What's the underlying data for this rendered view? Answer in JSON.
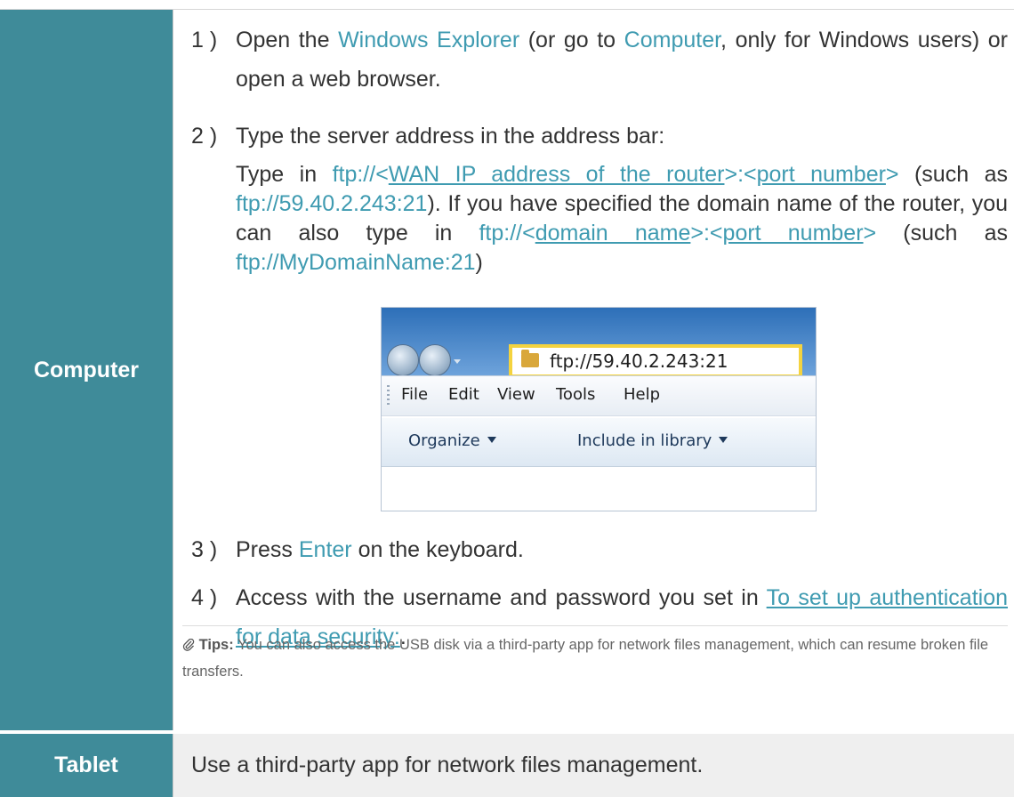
{
  "rows": {
    "computer": {
      "label": "Computer",
      "steps": [
        {
          "num": "1 )",
          "p1": "Open the ",
          "link1": "Windows Explorer",
          "p2": " (or go to ",
          "link2": "Computer",
          "p3": ", only for Windows users) or open a web browser."
        },
        {
          "num": "2 )",
          "text": "Type the server address in the address bar:",
          "detail": {
            "p1": "Type in ",
            "ftp1": "ftp://<",
            "ftp1_u": "WAN IP address of the router",
            "ftp1_mid": ">:<",
            "ftp1_u2": "port number",
            "ftp1_end": ">",
            "p2": " (such as ",
            "ex1": "ftp://59.40.2.243:21",
            "p3": "). If you have specified the domain name of the router, you can also type in ",
            "ftp2": "ftp://<",
            "ftp2_u": "domain name",
            "ftp2_mid": ">:<",
            "ftp2_u2": "port number",
            "ftp2_end": ">",
            "p4": " (such as ",
            "ex2": "ftp://MyDomainName:21",
            "p5": ")"
          }
        },
        {
          "num": "3 )",
          "p1": "Press ",
          "link1": "Enter",
          "p2": " on the keyboard."
        },
        {
          "num": "4 )",
          "p1": "Access with the username and password you set in ",
          "link1": "To set up authentication for data security:",
          "p2": "."
        }
      ],
      "explorer": {
        "address": "ftp://59.40.2.243:21",
        "menu": [
          "File",
          "Edit",
          "View",
          "Tools",
          "Help"
        ],
        "commands": [
          "Organize",
          "Include in library"
        ]
      },
      "tips": {
        "label": "Tips:",
        "text": " You can also access the USB disk via a third-party app for network files management, which can resume broken file transfers."
      }
    },
    "tablet": {
      "label": "Tablet",
      "text": "Use a third-party app for network files management."
    }
  },
  "colors": {
    "label_bg": "#3f8b99",
    "link": "#3f9bb1",
    "highlight_border": "#f4d33f"
  }
}
